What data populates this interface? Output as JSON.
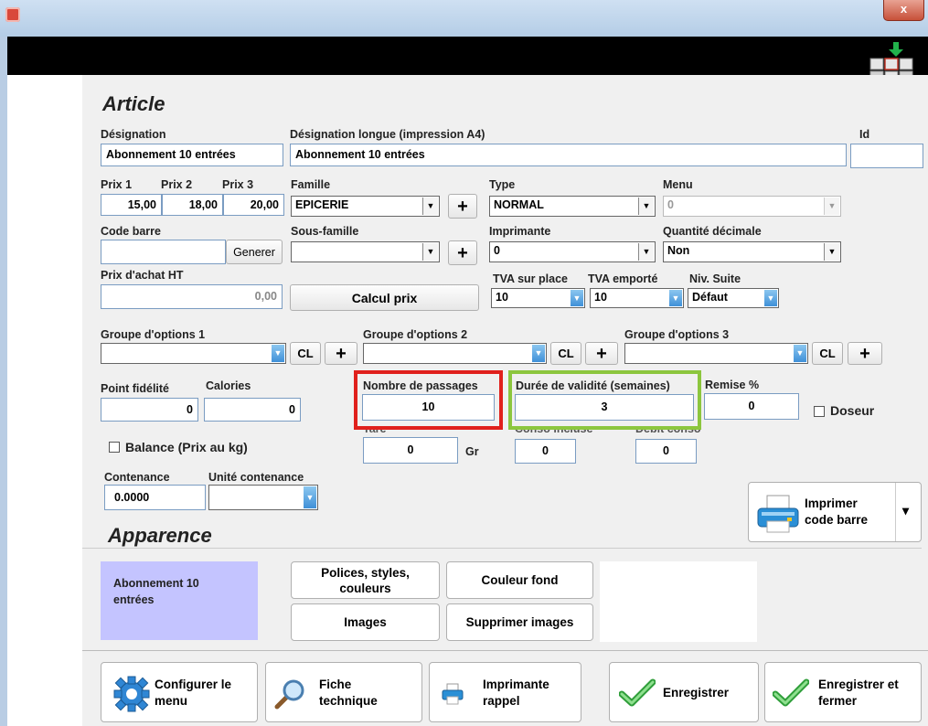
{
  "window": {
    "close_label": "x"
  },
  "sections": {
    "article": "Article",
    "apparence": "Apparence"
  },
  "designation": {
    "label": "Désignation",
    "value": "Abonnement 10 entrées"
  },
  "designation_longue": {
    "label": "Désignation longue (impression A4)",
    "value": "Abonnement 10 entrées"
  },
  "id": {
    "label": "Id",
    "value": ""
  },
  "prix": {
    "labels": [
      "Prix 1",
      "Prix 2",
      "Prix 3"
    ],
    "values": [
      "15,00",
      "18,00",
      "20,00"
    ]
  },
  "famille": {
    "label": "Famille",
    "value": "EPICERIE",
    "plus": "+"
  },
  "type": {
    "label": "Type",
    "value": "NORMAL"
  },
  "menu": {
    "label": "Menu",
    "value": "0"
  },
  "code_barre": {
    "label": "Code barre",
    "value": "",
    "generer": "Generer"
  },
  "sous_famille": {
    "label": "Sous-famille",
    "value": "",
    "plus": "+"
  },
  "imprimante": {
    "label": "Imprimante",
    "value": "0"
  },
  "quantite_decimale": {
    "label": "Quantité décimale",
    "value": "Non"
  },
  "prix_achat": {
    "label": "Prix d'achat HT",
    "value": "0,00",
    "calcul": "Calcul prix"
  },
  "tva_sur_place": {
    "label": "TVA sur place",
    "value": "10"
  },
  "tva_emporte": {
    "label": "TVA emporté",
    "value": "10"
  },
  "niv_suite": {
    "label": "Niv. Suite",
    "value": "Défaut"
  },
  "groupes": [
    {
      "label": "Groupe d'options 1",
      "value": "",
      "cl": "CL",
      "plus": "+"
    },
    {
      "label": "Groupe d'options 2",
      "value": "",
      "cl": "CL",
      "plus": "+"
    },
    {
      "label": "Groupe d'options 3",
      "value": "",
      "cl": "CL",
      "plus": "+"
    }
  ],
  "point_fidelite": {
    "label": "Point fidélité",
    "value": "0"
  },
  "calories": {
    "label": "Calories",
    "value": "0"
  },
  "nombre_passages": {
    "label": "Nombre de passages",
    "value": "10",
    "highlight": "#e0201c"
  },
  "duree_validite": {
    "label": "Durée de validité (semaines)",
    "value": "3",
    "highlight": "#8cc63e"
  },
  "remise": {
    "label": "Remise %",
    "value": "0"
  },
  "doseur": {
    "label": "Doseur"
  },
  "balance": {
    "label": "Balance (Prix au kg)"
  },
  "tare": {
    "label": "Tare",
    "value": "0",
    "unit": "Gr"
  },
  "conso_incluse": {
    "label": "Conso incluse",
    "value": "0"
  },
  "debit_conso": {
    "label": "Débit conso",
    "value": "0"
  },
  "contenance": {
    "label": "Contenance",
    "value": "0.0000"
  },
  "unite_contenance": {
    "label": "Unité contenance",
    "value": ""
  },
  "imprimer_code_barre": {
    "line1": "Imprimer",
    "line2": "code barre",
    "dropdown": "▾"
  },
  "preview": {
    "line1": "Abonnement 10",
    "line2": "entrées",
    "bg": "#c4c4ff"
  },
  "apparence_buttons": {
    "polices_1": "Polices, styles,",
    "polices_2": "couleurs",
    "couleur_fond": "Couleur fond",
    "images": "Images",
    "supprimer_images": "Supprimer images"
  },
  "bottom_buttons": {
    "configurer_1": "Configurer le",
    "configurer_2": "menu",
    "fiche_1": "Fiche",
    "fiche_2": "technique",
    "imprimante_1": "Imprimante",
    "imprimante_2": "rappel",
    "enregistrer": "Enregistrer",
    "enregistrer_fermer_1": "Enregistrer et",
    "enregistrer_fermer_2": "fermer"
  }
}
